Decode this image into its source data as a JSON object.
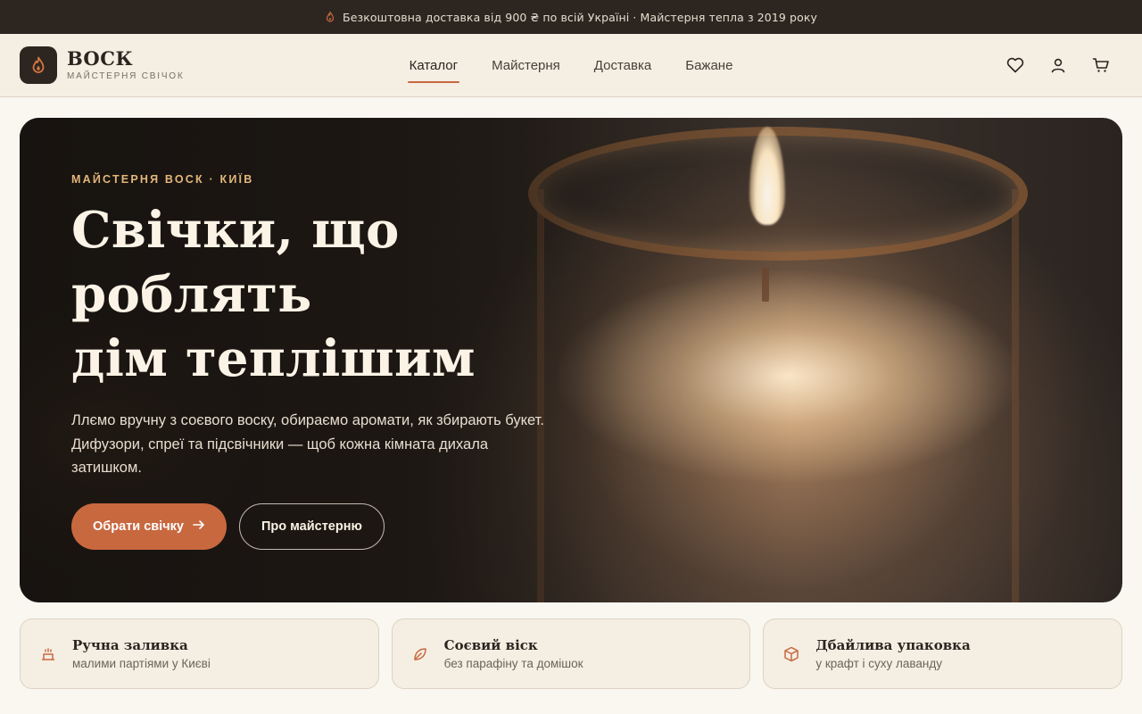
{
  "announcement": {
    "text": "Безкоштовна доставка від 900 ₴ по всій Україні · Майстерня тепла з 2019 року",
    "icon": "flame-icon"
  },
  "brand": {
    "name": "ВОСК",
    "tagline": "МАЙСТЕРНЯ СВІЧОК"
  },
  "nav": {
    "items": [
      {
        "label": "Каталог",
        "active": true
      },
      {
        "label": "Майстерня",
        "active": false
      },
      {
        "label": "Доставка",
        "active": false
      },
      {
        "label": "Бажане",
        "active": false
      }
    ]
  },
  "header_icons": [
    "heart-icon",
    "user-icon",
    "cart-icon"
  ],
  "hero": {
    "eyebrow": "МАЙСТЕРНЯ ВОСК · КИЇВ",
    "title": "Свічки, що\nроблять\nдім теплішим",
    "description": "Ллємо вручну з соєвого воску, обираємо аромати, як збирають букет. Дифузори, спреї та підсвічники — щоб кожна кімната дихала затишком.",
    "primary_button": "Обрати свічку",
    "secondary_button": "Про майстерню"
  },
  "features": [
    {
      "title": "Ручна заливка",
      "subtitle": "малими партіями у Києві",
      "icon": "candle-icon"
    },
    {
      "title": "Соєвий віск",
      "subtitle": "без парафіну та домішок",
      "icon": "leaf-icon"
    },
    {
      "title": "Дбайлива упаковка",
      "subtitle": "у крафт і суху лаванду",
      "icon": "box-icon"
    }
  ],
  "colors": {
    "accent": "#c8683f",
    "dark": "#2d2620",
    "cream": "#f4eee3",
    "eyebrow": "#e4b67a"
  }
}
